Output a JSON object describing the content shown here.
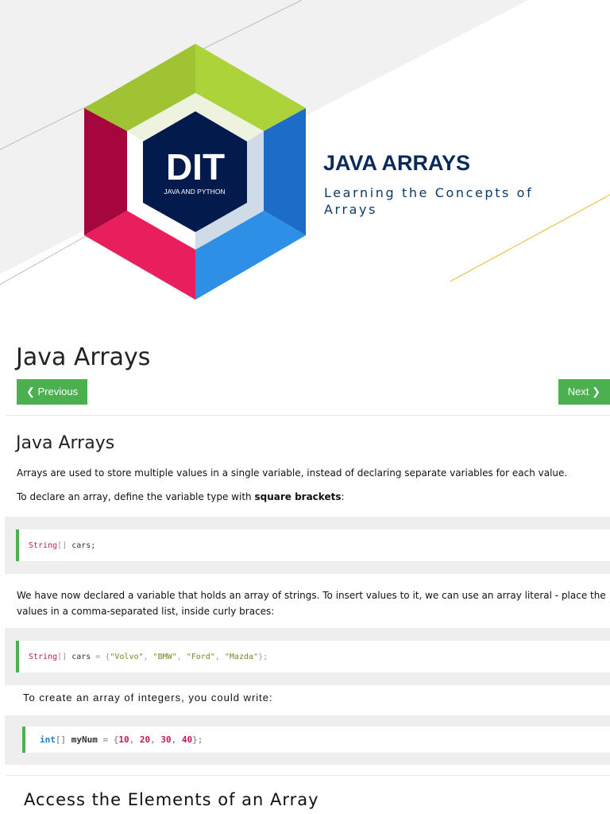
{
  "cover": {
    "logo_text": "DIT",
    "logo_subtext": "JAVA AND PYTHON",
    "title": "JAVA ARRAYS",
    "subtitle": "Learning the Concepts of Arrays",
    "colors": {
      "navy": "#031a4d",
      "green": "#a8d13a",
      "red": "#a6063e",
      "pink": "#e91e5c",
      "blue": "#1d6cc8",
      "lightblue": "#2e8fe6"
    }
  },
  "page": {
    "heading": "Java Arrays",
    "prev_label": "❮ Previous",
    "next_label": "Next ❯",
    "section_heading": "Java Arrays",
    "p1": "Arrays are used to store multiple values in a single variable, instead of declaring separate variables for each value.",
    "p2_pre": "To declare an array, define the variable type with ",
    "p2_bold": "square brackets",
    ":": "",
    "p2_post": ":",
    "code1": {
      "type": "String",
      "brackets": "[]",
      "rest": " cars;"
    },
    "p3": "We have now declared a variable that holds an array of strings. To insert values to it, we can use an array literal - place the values in a comma-separated list, inside curly braces:",
    "code2": {
      "type": "String",
      "brackets": "[]",
      "var": " cars ",
      "eq": "= {",
      "s1": "\"Volvo\"",
      "c1": ", ",
      "s2": "\"BMW\"",
      "c2": ", ",
      "s3": "\"Ford\"",
      "c3": ", ",
      "s4": "\"Mazda\"",
      "end": "};"
    },
    "p4": "To create an array of integers, you could write:",
    "code3": {
      "type": "int",
      "brackets": "[]",
      "var": " myNum ",
      "eq": "= {",
      "n1": "10",
      "c1": ", ",
      "n2": "20",
      "c2": ", ",
      "n3": "30",
      "c3": ", ",
      "n4": "40",
      "end": "};"
    },
    "next_heading": "Access the Elements of an Array"
  }
}
